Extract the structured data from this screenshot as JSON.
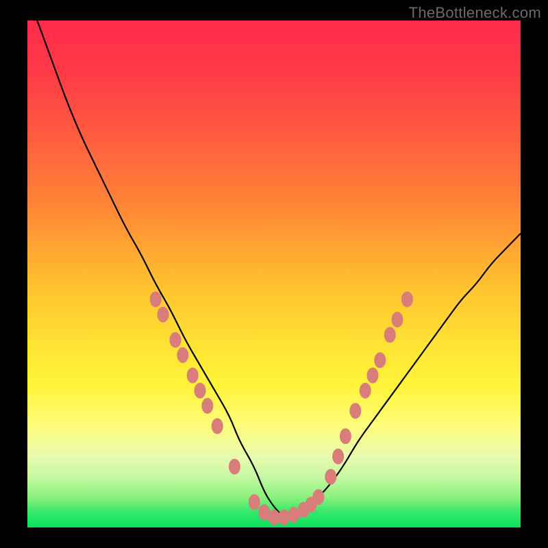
{
  "watermark": "TheBottleneck.com",
  "chart_data": {
    "type": "line",
    "title": "",
    "xlabel": "",
    "ylabel": "",
    "xlim": [
      0,
      100
    ],
    "ylim": [
      0,
      100
    ],
    "grid": false,
    "legend": false,
    "colors": {
      "curve": "#000000",
      "markers": "#d97d7b",
      "gradient_stops": [
        "#ff2a4b",
        "#ff8a35",
        "#ffe334",
        "#fdfc7a",
        "#8bf17c",
        "#0ce05d"
      ]
    },
    "series": [
      {
        "name": "curve",
        "x": [
          0,
          2,
          5,
          8,
          11,
          14,
          17,
          20,
          23,
          26,
          29,
          32,
          35,
          38,
          41,
          43,
          46,
          48,
          50,
          52,
          54,
          56,
          58,
          61,
          64,
          67,
          70,
          73,
          76,
          79,
          82,
          85,
          88,
          91,
          94,
          97,
          100
        ],
        "y": [
          105,
          100,
          92,
          84,
          77,
          71,
          65,
          59,
          54,
          48,
          43,
          37,
          32,
          27,
          22,
          17,
          12,
          7,
          4,
          2,
          2,
          3,
          5,
          8,
          12,
          17,
          21,
          25,
          29,
          33,
          37,
          41,
          45,
          48,
          52,
          55,
          58
        ]
      }
    ],
    "markers": [
      {
        "x": 26,
        "y": 45
      },
      {
        "x": 27.5,
        "y": 42
      },
      {
        "x": 30,
        "y": 37
      },
      {
        "x": 31.5,
        "y": 34
      },
      {
        "x": 33.5,
        "y": 30
      },
      {
        "x": 35,
        "y": 27
      },
      {
        "x": 36.5,
        "y": 24
      },
      {
        "x": 38.5,
        "y": 20
      },
      {
        "x": 42,
        "y": 12
      },
      {
        "x": 46,
        "y": 5
      },
      {
        "x": 48,
        "y": 3
      },
      {
        "x": 50,
        "y": 2
      },
      {
        "x": 52,
        "y": 2
      },
      {
        "x": 54,
        "y": 2.5
      },
      {
        "x": 56,
        "y": 3.5
      },
      {
        "x": 57.5,
        "y": 4.5
      },
      {
        "x": 59,
        "y": 6
      },
      {
        "x": 61.5,
        "y": 10
      },
      {
        "x": 63,
        "y": 14
      },
      {
        "x": 64.5,
        "y": 18
      },
      {
        "x": 66.5,
        "y": 23
      },
      {
        "x": 68.5,
        "y": 27
      },
      {
        "x": 70,
        "y": 30
      },
      {
        "x": 71.5,
        "y": 33
      },
      {
        "x": 73.5,
        "y": 38
      },
      {
        "x": 75,
        "y": 41
      },
      {
        "x": 77,
        "y": 45
      }
    ]
  }
}
